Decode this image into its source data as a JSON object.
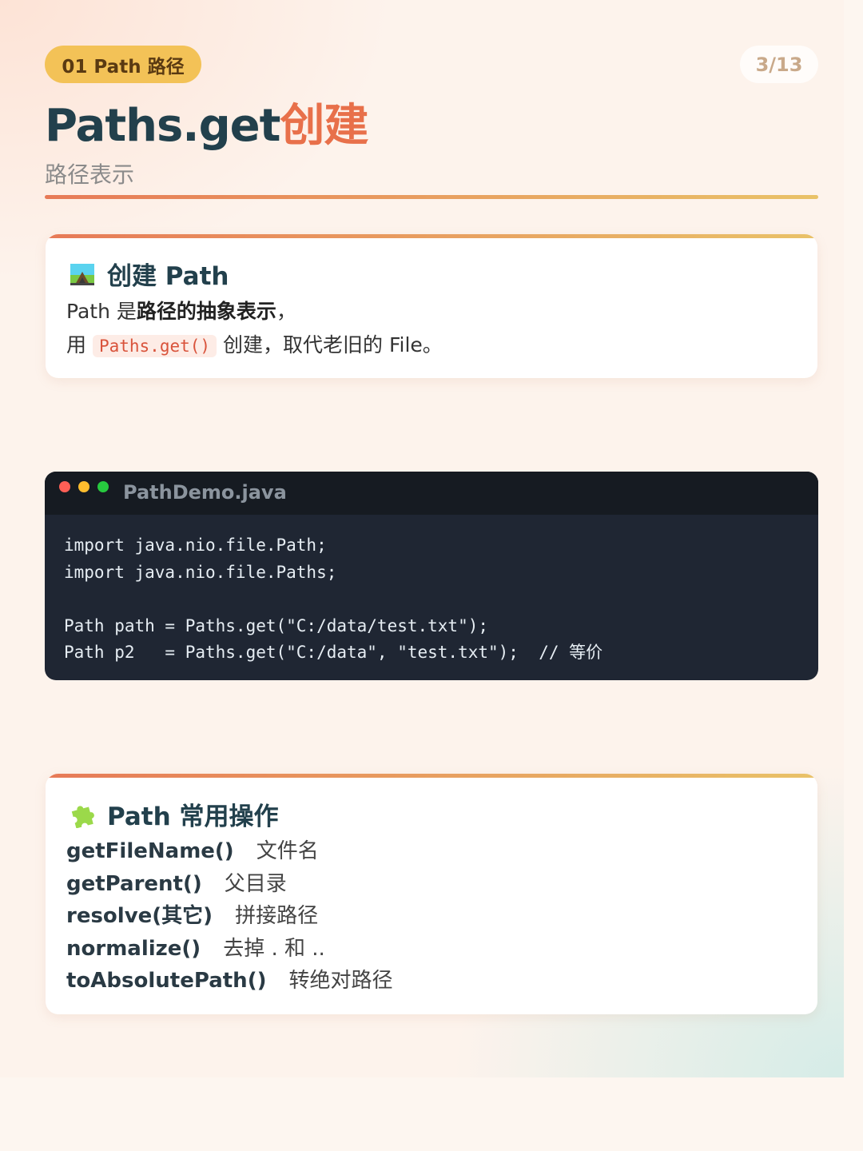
{
  "header": {
    "chip": "01 Path 路径",
    "page_counter": "3/13",
    "title_main": "Paths.get",
    "title_accent": "创建",
    "subtitle": "路径表示"
  },
  "card_create": {
    "icon": "mountain-railway-icon",
    "heading": "创建 Path",
    "line1_prefix": "Path 是",
    "line1_bold": "路径的抽象表示",
    "line1_suffix": "，",
    "line2_prefix": "用",
    "line2_code": "Paths.get()",
    "line2_suffix": "创建，取代老旧的 File。"
  },
  "code_window": {
    "filename": "PathDemo.java",
    "lines": [
      "import java.nio.file.Path;",
      "import java.nio.file.Paths;",
      "",
      "Path path = Paths.get(\"C:/data/test.txt\");",
      "Path p2   = Paths.get(\"C:/data\", \"test.txt\");  // 等价"
    ]
  },
  "card_ops": {
    "icon": "puzzle-piece-icon",
    "heading": "Path 常用操作",
    "ops": [
      {
        "name": "getFileName()",
        "desc": "文件名"
      },
      {
        "name": "getParent()",
        "desc": "父目录"
      },
      {
        "name": "resolve(其它)",
        "desc": "拼接路径"
      },
      {
        "name": "normalize()",
        "desc": "去掉 . 和 .."
      },
      {
        "name": "toAbsolutePath()",
        "desc": "转绝对路径"
      }
    ]
  },
  "colors": {
    "accent": "#e8704a",
    "title": "#22404c",
    "chip_bg": "#f3c257",
    "code_bg": "#1f2633"
  }
}
